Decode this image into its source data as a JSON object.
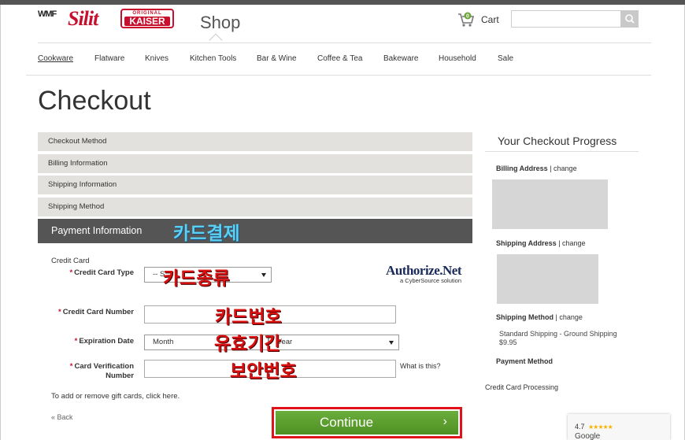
{
  "header": {
    "brands": {
      "wmf": "WMF",
      "silit": "Silit",
      "kaiser_top": "ORIGINAL",
      "kaiser_bottom": "KAISER"
    },
    "shop_title": "Shop",
    "cart_count": "0",
    "cart_label": "Cart",
    "search_placeholder": ""
  },
  "nav": {
    "items": [
      "Cookware",
      "Flatware",
      "Knives",
      "Kitchen Tools",
      "Bar & Wine",
      "Coffee & Tea",
      "Bakeware",
      "Household",
      "Sale"
    ],
    "active": "Cookware"
  },
  "page_title": "Checkout",
  "steps": [
    "Checkout Method",
    "Billing Information",
    "Shipping Information",
    "Shipping Method"
  ],
  "active_step": "Payment Information",
  "annotations": {
    "payment": "카드결제",
    "card_type": "카드종류",
    "card_number": "카드번호",
    "expiration": "유효기간",
    "security": "보안번호"
  },
  "form": {
    "section_heading": "Credit Card",
    "card_type_label": "Credit Card Type",
    "card_type_value": "-- S",
    "card_number_label": "Credit Card Number",
    "card_number_value": "",
    "expiration_label": "Expiration Date",
    "month_value": "Month",
    "year_value": "Year",
    "cvv_label_1": "Card Verification",
    "cvv_label_2": "Number",
    "cvv_value": "",
    "what_is_this": "What is this?",
    "required_mark": "*"
  },
  "authorize_net": {
    "name": "Authorize.Net",
    "tagline": "a CyberSource solution"
  },
  "gift_cards": {
    "text": "To add or remove gift cards,",
    "link": "click here."
  },
  "back_link": "« Back",
  "continue_label": "Continue",
  "continue_chevron": "›",
  "progress": {
    "title": "Your Checkout Progress",
    "billing_label": "Billing Address",
    "shipping_label": "Shipping Address",
    "method_label": "Shipping Method",
    "change": "| change",
    "method_line1": "Standard Shipping - Ground Shipping",
    "method_line2": "$9.95",
    "payment_label": "Payment Method",
    "payment_value": "Credit Card Processing"
  },
  "google_badge": {
    "rating": "4.7",
    "stars": "★★★★★",
    "name": "Google"
  },
  "colors": {
    "brand_red": "#c8102e",
    "continue_green": "#5a9e2e",
    "step_bg": "#e3e1dd",
    "active_step_bg": "#555555",
    "highlight_red": "#e0121a"
  }
}
